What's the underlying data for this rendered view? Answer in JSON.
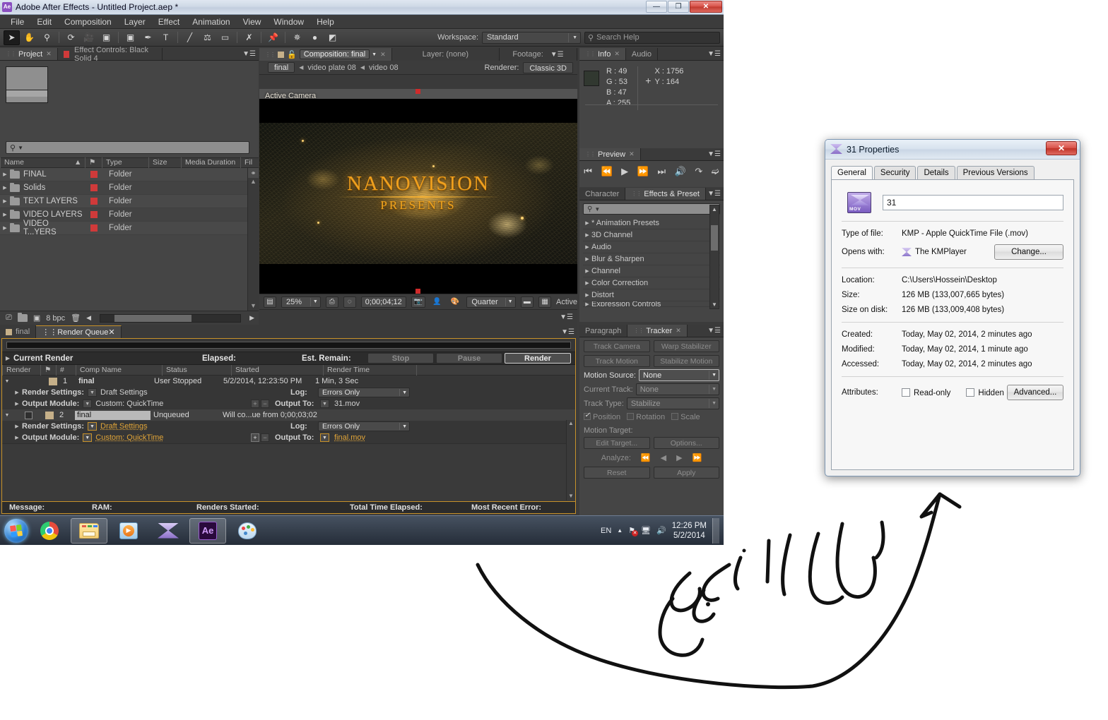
{
  "app": {
    "title": "Adobe After Effects - Untitled Project.aep *",
    "logo_text": "Ae",
    "window_controls": {
      "minimize": "—",
      "maximize": "❐",
      "close": "✕"
    },
    "menus": [
      "File",
      "Edit",
      "Composition",
      "Layer",
      "Effect",
      "Animation",
      "View",
      "Window",
      "Help"
    ],
    "toolbar": {
      "workspace_label": "Workspace:",
      "workspace_value": "Standard",
      "search_placeholder": "Search Help",
      "tools": [
        {
          "name": "selection-tool",
          "glyph": "➤"
        },
        {
          "name": "hand-tool",
          "glyph": "✋"
        },
        {
          "name": "zoom-tool",
          "glyph": "🔍"
        },
        {
          "name": "rotation-tool",
          "glyph": "↻"
        },
        {
          "name": "camera-tool",
          "glyph": "🎥"
        },
        {
          "name": "pan-behind-tool",
          "glyph": "⬚"
        },
        {
          "name": "shape-tool",
          "glyph": "▢"
        },
        {
          "name": "pen-tool",
          "glyph": "✒"
        },
        {
          "name": "type-tool",
          "glyph": "T"
        },
        {
          "name": "brush-tool",
          "glyph": "🖌"
        },
        {
          "name": "clone-stamp-tool",
          "glyph": "⚲"
        },
        {
          "name": "eraser-tool",
          "glyph": "◰"
        },
        {
          "name": "roto-brush-tool",
          "glyph": "✎"
        },
        {
          "name": "puppet-pin-tool",
          "glyph": "📌"
        },
        {
          "name": "anchor-point-icon",
          "glyph": "✥"
        },
        {
          "name": "dot-icon",
          "glyph": "●"
        },
        {
          "name": "mask-icon",
          "glyph": "◩"
        }
      ]
    }
  },
  "project_panel": {
    "tabs": [
      {
        "label": "Project",
        "active": true,
        "closable": true
      },
      {
        "label": "Effect Controls: Black Solid 4",
        "active": false,
        "closable": false
      }
    ],
    "search_placeholder": "",
    "columns": [
      "Name",
      "Type",
      "Size",
      "Media Duration",
      "Fil"
    ],
    "rows": [
      {
        "name": "FINAL",
        "type": "Folder"
      },
      {
        "name": "Solids",
        "type": "Folder"
      },
      {
        "name": "TEXT LAYERS",
        "type": "Folder"
      },
      {
        "name": "VIDEO LAYERS",
        "type": "Folder"
      },
      {
        "name": "VIDEO T...YERS",
        "type": "Folder"
      }
    ],
    "bit_depth": "8 bpc"
  },
  "comp_panel": {
    "tabs": [
      {
        "label": "Composition: final",
        "active": true
      },
      {
        "label": "Layer: (none)",
        "active": false
      },
      {
        "label": "Footage:",
        "active": false
      }
    ],
    "breadcrumbs": [
      "final",
      "video plate 08",
      "video 08"
    ],
    "renderer_label": "Renderer:",
    "renderer_value": "Classic 3D",
    "view_label": "Active Camera",
    "artwork": {
      "title": "NANOVISION",
      "subtitle": "PRESENTS"
    },
    "footer": {
      "zoom": "25%",
      "timecode": "0;00;04;12",
      "resolution": "Quarter",
      "view_state": "Active"
    }
  },
  "info_panel": {
    "tabs": [
      {
        "label": "Info",
        "active": true
      },
      {
        "label": "Audio",
        "active": false
      }
    ],
    "r": "R : 49",
    "g": "G : 53",
    "b": "B : 47",
    "a": "A : 255",
    "x": "X : 1756",
    "y": "Y : 164"
  },
  "preview_panel": {
    "tabs": [
      {
        "label": "Preview",
        "active": true
      }
    ],
    "controls": [
      "first-frame",
      "prev-frame",
      "play",
      "next-frame",
      "last-frame",
      "audio",
      "loop",
      "ram-preview"
    ]
  },
  "effects_panel": {
    "tabs": [
      {
        "label": "Character",
        "active": false
      },
      {
        "label": "Effects & Preset",
        "active": true
      }
    ],
    "search_placeholder": "",
    "items": [
      "* Animation Presets",
      "3D Channel",
      "Audio",
      "Blur & Sharpen",
      "Channel",
      "Color Correction",
      "Distort",
      "Expression Controls"
    ]
  },
  "tracker_panel": {
    "tabs": [
      {
        "label": "Paragraph",
        "active": false
      },
      {
        "label": "Tracker",
        "active": true
      }
    ],
    "buttons": [
      "Track Camera",
      "Warp Stabilizer",
      "Track Motion",
      "Stabilize Motion"
    ],
    "motion_source_label": "Motion Source:",
    "motion_source_value": "None",
    "current_track_label": "Current Track:",
    "current_track_value": "None",
    "track_type_label": "Track Type:",
    "track_type_value": "Stabilize",
    "checks": [
      {
        "label": "Position",
        "checked": true
      },
      {
        "label": "Rotation",
        "checked": false
      },
      {
        "label": "Scale",
        "checked": false
      }
    ],
    "motion_target_label": "Motion Target:",
    "edit_target": "Edit Target...",
    "options": "Options...",
    "analyze_label": "Analyze:",
    "reset": "Reset",
    "apply": "Apply"
  },
  "render_queue": {
    "tabs": [
      {
        "label": "final",
        "active": false
      },
      {
        "label": "Render Queue",
        "active": true
      }
    ],
    "current_render_label": "Current Render",
    "elapsed_label": "Elapsed:",
    "est_remain_label": "Est. Remain:",
    "stop_label": "Stop",
    "pause_label": "Pause",
    "render_label": "Render",
    "columns": [
      "Render",
      "#",
      "Comp Name",
      "Status",
      "Started",
      "Render Time"
    ],
    "items": [
      {
        "num": "1",
        "comp_name": "final",
        "status": "User Stopped",
        "started": "5/2/2014, 12:23:50 PM",
        "render_time": "1 Min, 3 Sec",
        "render_settings_label": "Render Settings:",
        "render_settings_value": "Draft Settings",
        "log_label": "Log:",
        "log_value": "Errors Only",
        "output_module_label": "Output Module:",
        "output_module_value": "Custom: QuickTime",
        "output_to_label": "Output To:",
        "output_to_value": "31.mov",
        "checked": false,
        "highlighted": false
      },
      {
        "num": "2",
        "comp_name": "final",
        "status": "Unqueued",
        "started": "Will co...ue from 0;00;03;02",
        "render_time": "",
        "render_settings_label": "Render Settings:",
        "render_settings_value": "Draft Settings",
        "log_label": "Log:",
        "log_value": "Errors Only",
        "output_module_label": "Output Module:",
        "output_module_value": "Custom: QuickTime",
        "output_to_label": "Output To:",
        "output_to_value": "final.mov",
        "checked": true,
        "highlighted": true
      }
    ],
    "status_bar": {
      "message": "Message:",
      "ram": "RAM:",
      "renders_started": "Renders Started:",
      "total_time": "Total Time Elapsed:",
      "recent_error": "Most Recent Error:"
    }
  },
  "taskbar": {
    "items": [
      {
        "name": "start-orb"
      },
      {
        "name": "taskbar-chrome"
      },
      {
        "name": "taskbar-explorer"
      },
      {
        "name": "taskbar-media-player"
      },
      {
        "name": "taskbar-kmplayer"
      },
      {
        "name": "taskbar-after-effects",
        "label": "Ae"
      },
      {
        "name": "taskbar-paint"
      }
    ],
    "language": "EN",
    "time": "12:26 PM",
    "date": "5/2/2014"
  },
  "properties_dialog": {
    "title": "31 Properties",
    "close_label": "✕",
    "tabs": [
      {
        "label": "General",
        "active": true
      },
      {
        "label": "Security",
        "active": false
      },
      {
        "label": "Details",
        "active": false
      },
      {
        "label": "Previous Versions",
        "active": false
      }
    ],
    "file_icon_tag": "MOV",
    "file_name": "31",
    "rows": [
      {
        "key": "Type of file:",
        "value": "KMP - Apple QuickTime File (.mov)"
      },
      {
        "key": "Opens with:",
        "value": "The KMPlayer",
        "button": "Change..."
      },
      {
        "key": "Location:",
        "value": "C:\\Users\\Hossein\\Desktop"
      },
      {
        "key": "Size:",
        "value": "126 MB (133,007,665 bytes)"
      },
      {
        "key": "Size on disk:",
        "value": "126 MB (133,009,408 bytes)"
      },
      {
        "key": "Created:",
        "value": "Today, May 02, 2014, 2 minutes ago"
      },
      {
        "key": "Modified:",
        "value": "Today, May 02, 2014, 1 minute ago"
      },
      {
        "key": "Accessed:",
        "value": "Today, May 02, 2014, 2 minutes ago"
      }
    ],
    "attributes_label": "Attributes:",
    "readonly_label": "Read-only",
    "hidden_label": "Hidden",
    "advanced_label": "Advanced..."
  },
  "annotation": {
    "text": "پس از خروج"
  }
}
